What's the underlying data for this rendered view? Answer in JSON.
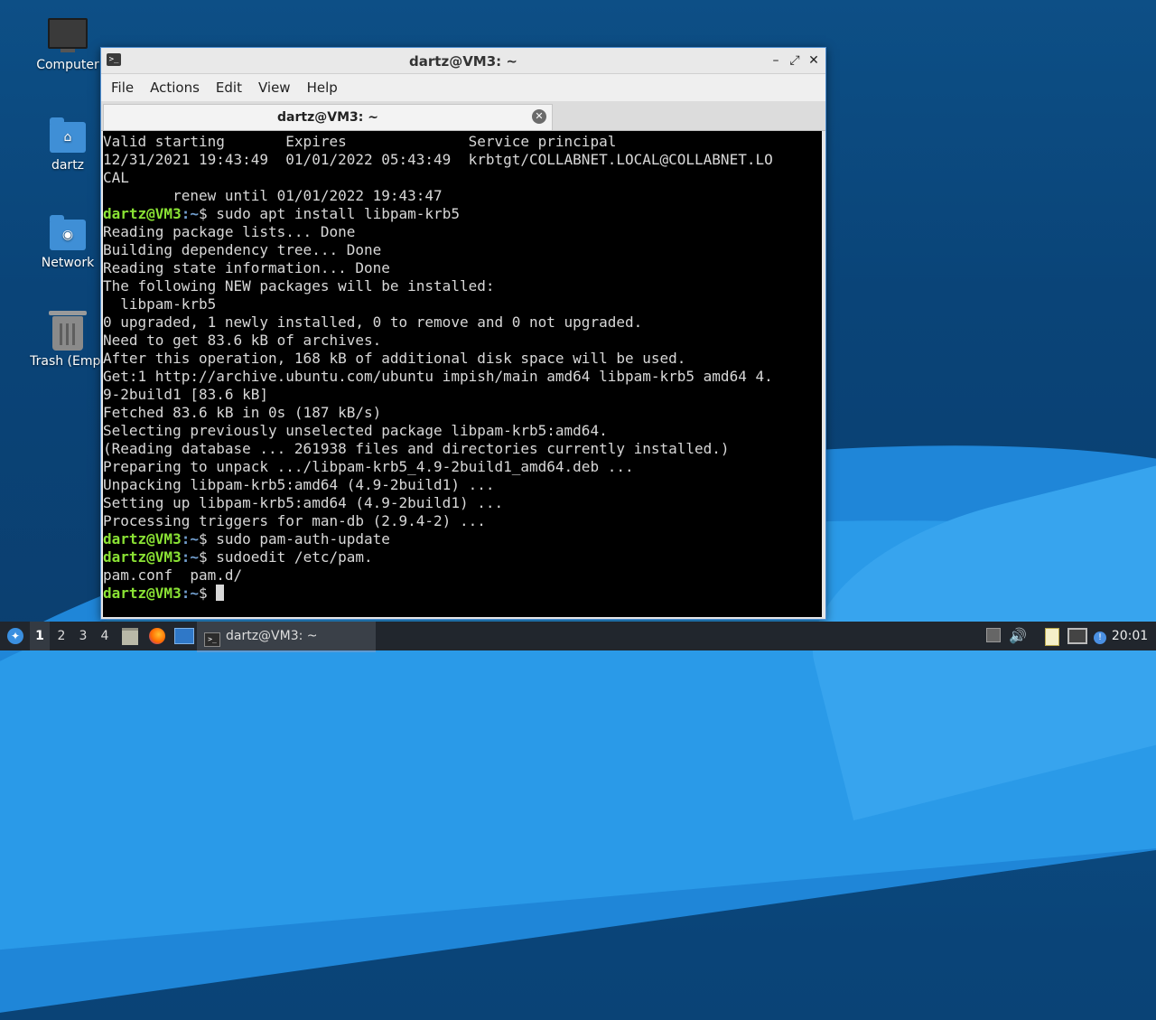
{
  "desktop": {
    "icons": [
      {
        "label": "Computer"
      },
      {
        "label": "dartz"
      },
      {
        "label": "Network"
      },
      {
        "label": "Trash (Empt"
      }
    ]
  },
  "window": {
    "title": "dartz@VM3: ~",
    "app_icon": ">_",
    "controls": {
      "minimize": "–",
      "maximize": "⤢",
      "close": "✕"
    },
    "menu": [
      "File",
      "Actions",
      "Edit",
      "View",
      "Help"
    ],
    "tab": {
      "label": "dartz@VM3: ~",
      "close": "✕"
    }
  },
  "terminal": {
    "prompt_user": "dartz@VM3",
    "prompt_path": ":~",
    "prompt_symbol": "$ ",
    "lines": [
      {
        "type": "out",
        "text": "Valid starting       Expires              Service principal"
      },
      {
        "type": "out",
        "text": "12/31/2021 19:43:49  01/01/2022 05:43:49  krbtgt/COLLABNET.LOCAL@COLLABNET.LO"
      },
      {
        "type": "out",
        "text": "CAL"
      },
      {
        "type": "out",
        "text": "        renew until 01/01/2022 19:43:47"
      },
      {
        "type": "cmd",
        "text": "sudo apt install libpam-krb5"
      },
      {
        "type": "out",
        "text": "Reading package lists... Done"
      },
      {
        "type": "out",
        "text": "Building dependency tree... Done"
      },
      {
        "type": "out",
        "text": "Reading state information... Done"
      },
      {
        "type": "out",
        "text": "The following NEW packages will be installed:"
      },
      {
        "type": "out",
        "text": "  libpam-krb5"
      },
      {
        "type": "out",
        "text": "0 upgraded, 1 newly installed, 0 to remove and 0 not upgraded."
      },
      {
        "type": "out",
        "text": "Need to get 83.6 kB of archives."
      },
      {
        "type": "out",
        "text": "After this operation, 168 kB of additional disk space will be used."
      },
      {
        "type": "out",
        "text": "Get:1 http://archive.ubuntu.com/ubuntu impish/main amd64 libpam-krb5 amd64 4."
      },
      {
        "type": "out",
        "text": "9-2build1 [83.6 kB]"
      },
      {
        "type": "out",
        "text": "Fetched 83.6 kB in 0s (187 kB/s)"
      },
      {
        "type": "out",
        "text": "Selecting previously unselected package libpam-krb5:amd64."
      },
      {
        "type": "out",
        "text": "(Reading database ... 261938 files and directories currently installed.)"
      },
      {
        "type": "out",
        "text": "Preparing to unpack .../libpam-krb5_4.9-2build1_amd64.deb ..."
      },
      {
        "type": "out",
        "text": "Unpacking libpam-krb5:amd64 (4.9-2build1) ..."
      },
      {
        "type": "out",
        "text": "Setting up libpam-krb5:amd64 (4.9-2build1) ..."
      },
      {
        "type": "out",
        "text": "Processing triggers for man-db (2.9.4-2) ..."
      },
      {
        "type": "cmd",
        "text": "sudo pam-auth-update"
      },
      {
        "type": "cmd",
        "text": "sudoedit /etc/pam."
      },
      {
        "type": "out",
        "text": "pam.conf  pam.d/"
      },
      {
        "type": "cmd",
        "text": "",
        "cursor": true
      }
    ]
  },
  "taskbar": {
    "workspaces": [
      "1",
      "2",
      "3",
      "4"
    ],
    "active_workspace": "1",
    "task_label": "dartz@VM3: ~",
    "clock": "20:01"
  }
}
